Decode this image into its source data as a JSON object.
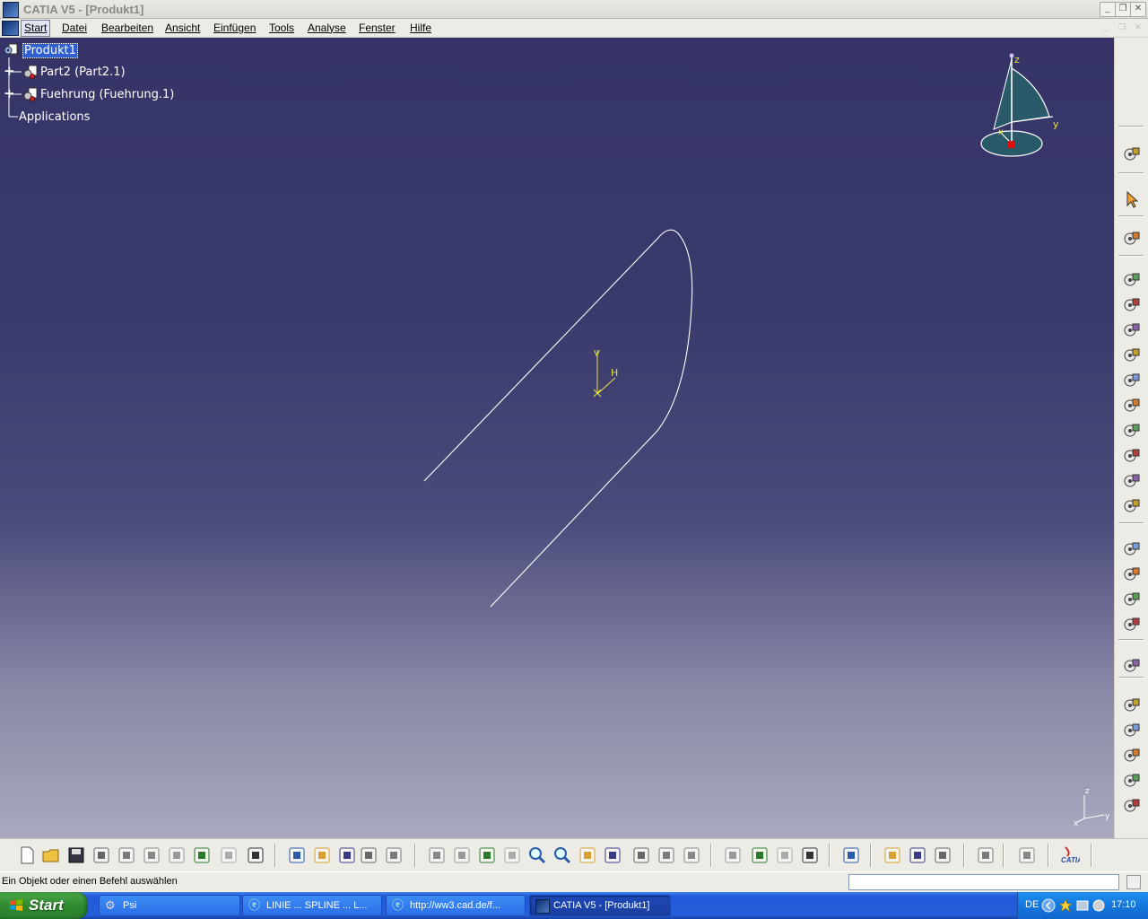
{
  "window": {
    "title": "CATIA V5 - [Produkt1]",
    "buttons": [
      "minimize",
      "maximize",
      "close"
    ]
  },
  "menu": {
    "items": [
      "Start",
      "Datei",
      "Bearbeiten",
      "Ansicht",
      "Einfügen",
      "Tools",
      "Analyse",
      "Fenster",
      "Hilfe"
    ]
  },
  "tree": {
    "root": "Produkt1",
    "children": [
      {
        "label": "Part2 (Part2.1)",
        "icon": "part-icon"
      },
      {
        "label": "Fuehrung (Fuehrung.1)",
        "icon": "part-icon"
      }
    ],
    "applications": "Applications"
  },
  "compass": {
    "labels": [
      "z",
      "y",
      "x"
    ]
  },
  "sketch_axis": {
    "v_label": "V",
    "h_label": "H"
  },
  "corner_axis": {
    "labels": [
      "z",
      "y",
      "x"
    ]
  },
  "right_toolbar": {
    "icons": [
      "catalog-gears-icon",
      "select-arrow-icon",
      "manipulation-icon",
      "new-component-icon",
      "new-product-icon",
      "new-part-icon",
      "existing-component-icon",
      "replace-component-icon",
      "graph-tree-reorder-icon",
      "generate-numbering-icon",
      "reuse-pattern-icon",
      "multi-instantiation-icon",
      "explode-icon",
      "manipulate-icon",
      "snap-icon",
      "smart-move-icon",
      "update-icon",
      "clash-icon",
      "coincidence-constraint-icon",
      "contact-constraint-icon",
      "offset-constraint-icon",
      "angle-constraint-icon",
      "fix-component-icon"
    ]
  },
  "bottom_toolbar": {
    "icons": [
      "new-file-icon",
      "open-file-icon",
      "save-icon",
      "print-icon",
      "cut-icon",
      "copy-icon",
      "paste-icon",
      "undo-icon",
      "redo-icon",
      "whats-this-icon",
      "formula-icon",
      "comment-icon",
      "anchor-icon",
      "table-icon",
      "tree-expand-icon",
      "fly-mode-icon",
      "fit-all-icon",
      "pan-icon",
      "rotate-icon",
      "zoom-in-icon",
      "zoom-out-icon",
      "normal-view-icon",
      "views-icon",
      "render-style-icon",
      "hide-show-icon",
      "swap-visible-icon",
      "measure-between-icon",
      "measure-item-icon",
      "measure-inertia-icon",
      "catalog-icon",
      "bill-of-material-icon",
      "save-management-icon",
      "publication-icon",
      "update-all-icon",
      "material-icon",
      "scene-icon",
      "catia-logo-icon"
    ]
  },
  "status": {
    "message": "Ein Objekt oder einen Befehl auswählen",
    "command_placeholder": ""
  },
  "taskbar": {
    "start": "Start",
    "buttons": [
      {
        "label": "Psi",
        "active": false
      },
      {
        "label": "LINIE ... SPLINE ... L...",
        "active": false
      },
      {
        "label": "http://ww3.cad.de/f...",
        "active": false
      },
      {
        "label": "CATIA V5 - [Produkt1]",
        "active": true
      }
    ],
    "language": "DE",
    "time": "17:10"
  },
  "colors": {
    "viewport_top": "#363466",
    "viewport_bottom": "#a9a9c0",
    "selection": "#2f5fd0",
    "geometry": "#ffffff",
    "axis": "#e8e040"
  }
}
